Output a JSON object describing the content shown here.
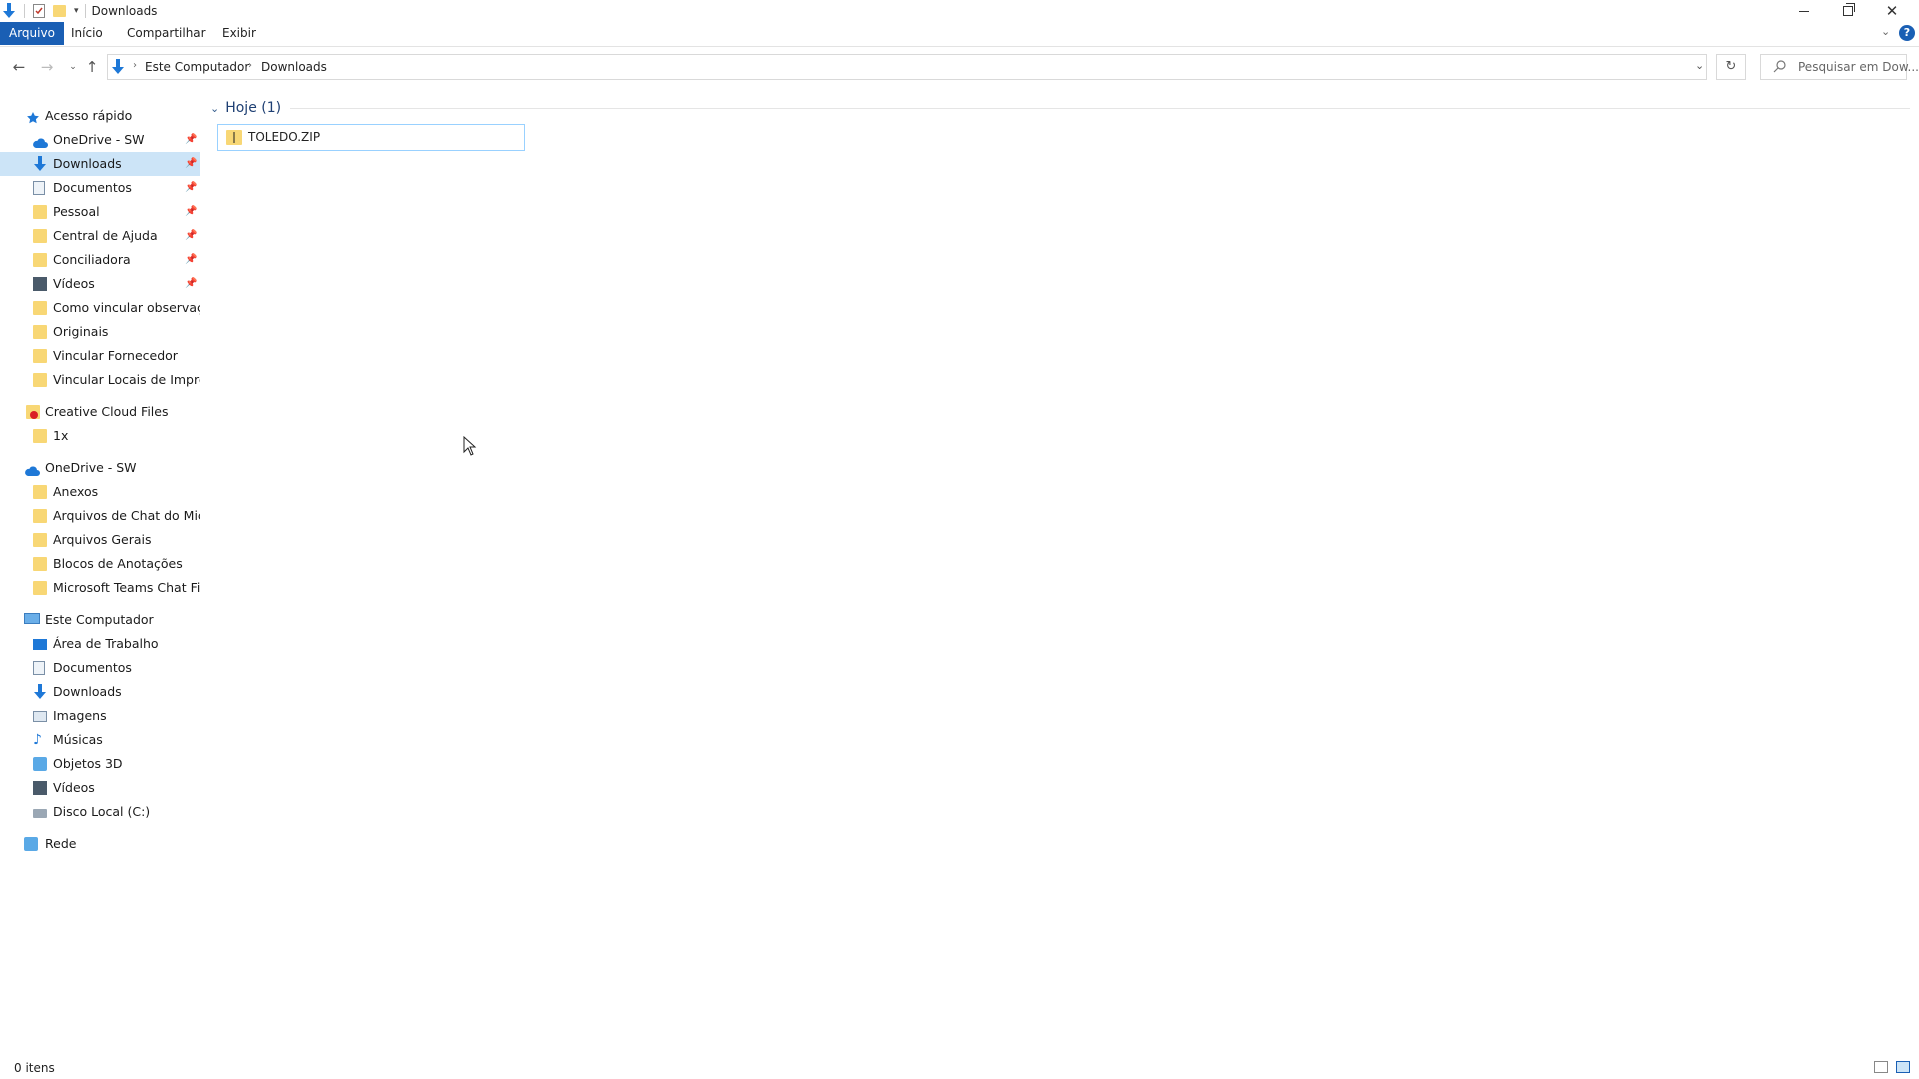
{
  "window": {
    "title": "Downloads"
  },
  "ribbon": {
    "tabs": [
      "Arquivo",
      "Início",
      "Compartilhar",
      "Exibir"
    ]
  },
  "address": {
    "segments": [
      "Este Computador",
      "Downloads"
    ]
  },
  "search": {
    "placeholder": "Pesquisar em Dow..."
  },
  "sidebar": {
    "quick_access": {
      "label": "Acesso rápido",
      "items": [
        {
          "label": "OneDrive - SW",
          "icon": "cloud-icon",
          "pinned": true
        },
        {
          "label": "Downloads",
          "icon": "download-arrow-icon",
          "pinned": true,
          "selected": true
        },
        {
          "label": "Documentos",
          "icon": "document-icon",
          "pinned": true
        },
        {
          "label": "Pessoal",
          "icon": "folder-icon",
          "pinned": true
        },
        {
          "label": "Central de Ajuda",
          "icon": "folder-icon",
          "pinned": true
        },
        {
          "label": "Conciliadora",
          "icon": "folder-icon",
          "pinned": true
        },
        {
          "label": "Vídeos",
          "icon": "video-icon",
          "pinned": true
        },
        {
          "label": "Como vincular observações",
          "icon": "folder-icon",
          "pinned": false
        },
        {
          "label": "Originais",
          "icon": "folder-icon",
          "pinned": false
        },
        {
          "label": "Vincular Fornecedor",
          "icon": "folder-icon",
          "pinned": false
        },
        {
          "label": "Vincular Locais de Impressã",
          "icon": "folder-icon",
          "pinned": false
        }
      ]
    },
    "creative_cloud": {
      "label": "Creative Cloud Files",
      "items": [
        {
          "label": "1x",
          "icon": "folder-icon"
        }
      ]
    },
    "onedrive": {
      "label": "OneDrive - SW",
      "items": [
        {
          "label": "Anexos",
          "icon": "folder-icon"
        },
        {
          "label": "Arquivos de Chat do Micros",
          "icon": "folder-icon"
        },
        {
          "label": "Arquivos Gerais",
          "icon": "folder-icon"
        },
        {
          "label": "Blocos de Anotações",
          "icon": "folder-icon"
        },
        {
          "label": "Microsoft Teams Chat Files",
          "icon": "folder-icon"
        }
      ]
    },
    "this_pc": {
      "label": "Este Computador",
      "items": [
        {
          "label": "Área de Trabalho",
          "icon": "desktop-icon"
        },
        {
          "label": "Documentos",
          "icon": "document-icon"
        },
        {
          "label": "Downloads",
          "icon": "download-arrow-icon"
        },
        {
          "label": "Imagens",
          "icon": "pictures-icon"
        },
        {
          "label": "Músicas",
          "icon": "music-icon"
        },
        {
          "label": "Objetos 3D",
          "icon": "cube-icon"
        },
        {
          "label": "Vídeos",
          "icon": "video-icon"
        },
        {
          "label": "Disco Local (C:)",
          "icon": "drive-icon"
        }
      ]
    },
    "network": {
      "label": "Rede"
    }
  },
  "content": {
    "group_label": "Hoje (1)",
    "files": [
      {
        "name": "TOLEDO.ZIP",
        "icon": "zip-folder-icon"
      }
    ]
  },
  "status": {
    "text": "0 itens"
  },
  "colors": {
    "accent": "#1a5fb4",
    "selection": "#cce4f7",
    "folder": "#f8d775",
    "hover_border": "#99d1ff"
  }
}
